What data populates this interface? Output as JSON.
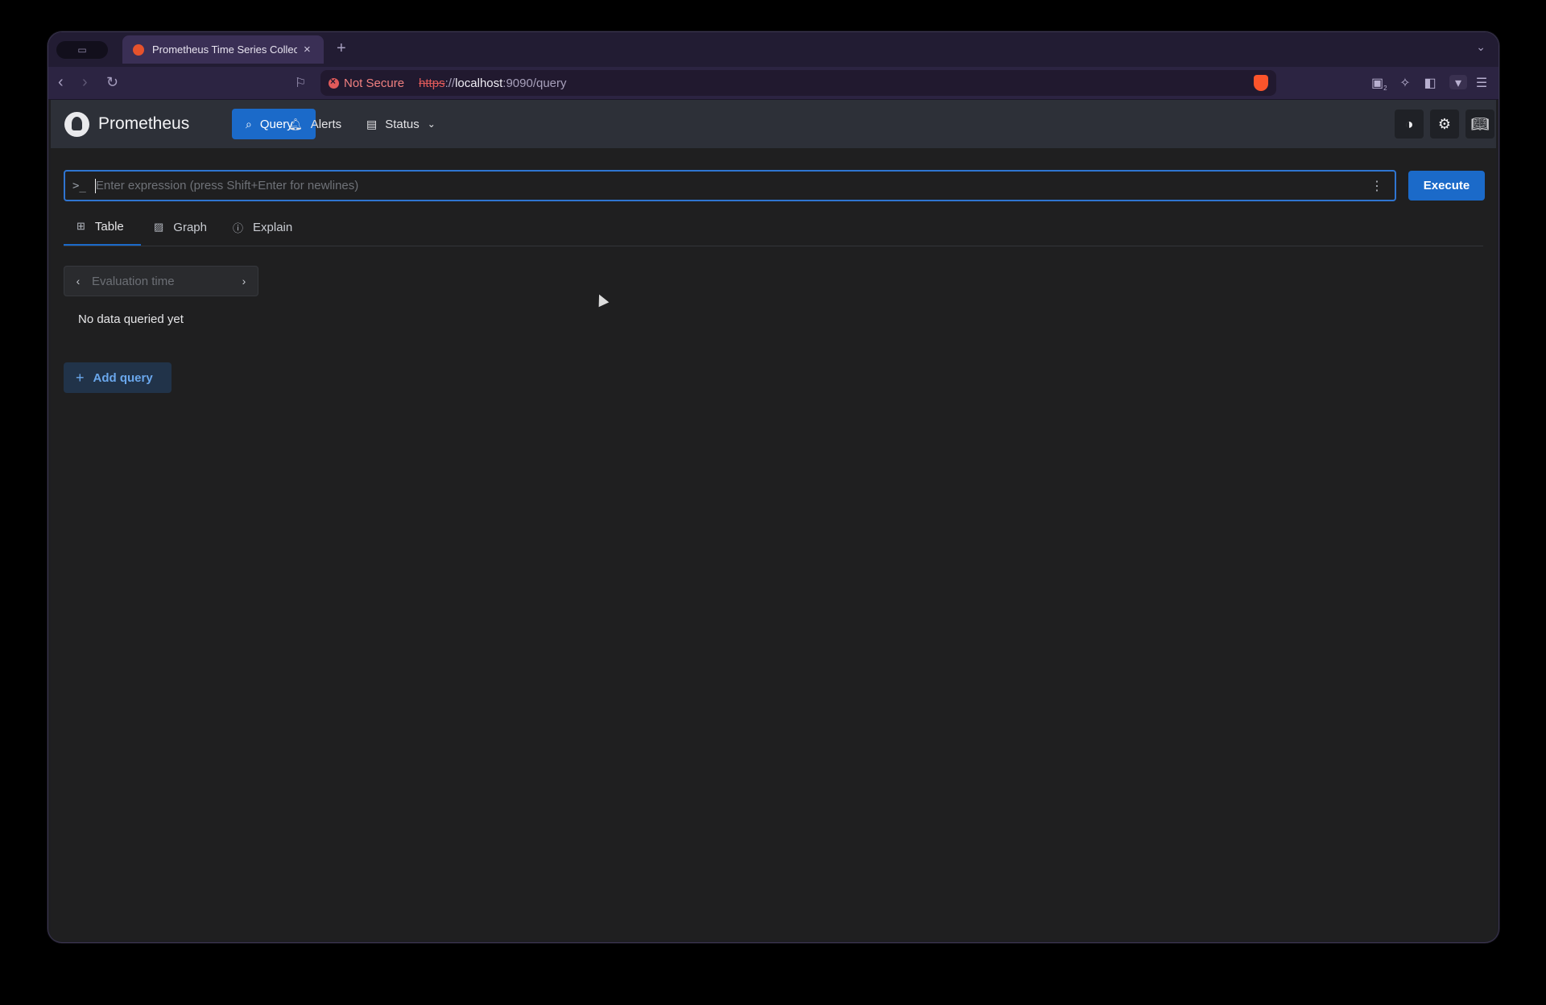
{
  "browser": {
    "tab_title": "Prometheus Time Series Collection",
    "tab_close": "×",
    "new_tab": "+",
    "not_secure": "Not Secure",
    "url_scheme": "https",
    "url_sep": "://",
    "url_host": "localhost",
    "url_rest": ":9090/query",
    "extension_badge": "2"
  },
  "app": {
    "brand": "Prometheus",
    "nav": {
      "query": "Query",
      "alerts": "Alerts",
      "status": "Status"
    },
    "expression": {
      "prompt": ">_",
      "placeholder": "Enter expression (press Shift+Enter for newlines)",
      "value": ""
    },
    "execute_label": "Execute",
    "tabs": {
      "table": "Table",
      "graph": "Graph",
      "explain": "Explain"
    },
    "eval_time_placeholder": "Evaluation time",
    "no_data": "No data queried yet",
    "add_query": "Add query",
    "accent_color": "#1b6ac9"
  }
}
